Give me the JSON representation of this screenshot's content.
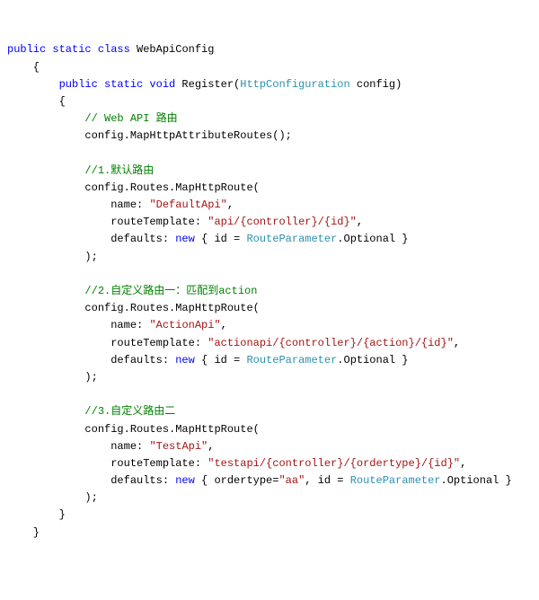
{
  "code": {
    "line1_kw": "public static class",
    "line1_cls": " WebApiConfig",
    "lbrace1": "    {",
    "line2_indent": "        ",
    "line2_kw": "public static void",
    "line2_method": " Register(",
    "line2_cls": "HttpConfiguration",
    "line2_end": " config)",
    "lbrace2": "        {",
    "cmt1_indent": "            ",
    "cmt1": "// Web API 路由",
    "map_indent": "            config.MapHttpAttributeRoutes();",
    "blank": "",
    "cmt2_indent": "            ",
    "cmt2": "//1.默认路由",
    "r1a": "            config.Routes.MapHttpRoute(",
    "r1b_pre": "                name: ",
    "r1b_str": "\"DefaultApi\"",
    "r1b_post": ",",
    "r1c_pre": "                routeTemplate: ",
    "r1c_str": "\"api/{controller}/{id}\"",
    "r1c_post": ",",
    "r1d_pre": "                defaults: ",
    "r1d_kw": "new ",
    "r1d_body": "{ id = ",
    "r1d_cls": "RouteParameter",
    "r1d_end": ".Optional }",
    "r1e": "            );",
    "cmt3_indent": "            ",
    "cmt3": "//2.自定义路由一：匹配到action",
    "r2a": "            config.Routes.MapHttpRoute(",
    "r2b_pre": "                name: ",
    "r2b_str": "\"ActionApi\"",
    "r2b_post": ",",
    "r2c_pre": "                routeTemplate: ",
    "r2c_str": "\"actionapi/{controller}/{action}/{id}\"",
    "r2c_post": ",",
    "r2d_pre": "                defaults: ",
    "r2d_kw": "new ",
    "r2d_body": "{ id = ",
    "r2d_cls": "RouteParameter",
    "r2d_end": ".Optional }",
    "r2e": "            );",
    "cmt4_indent": "            ",
    "cmt4": "//3.自定义路由二",
    "r3a": "            config.Routes.MapHttpRoute(",
    "r3b_pre": "                name: ",
    "r3b_str": "\"TestApi\"",
    "r3b_post": ",",
    "r3c_pre": "                routeTemplate: ",
    "r3c_str": "\"testapi/{controller}/{ordertype}/{id}\"",
    "r3c_post": ",",
    "r3d_pre": "                defaults: ",
    "r3d_kw": "new ",
    "r3d_body": "{ ordertype=",
    "r3d_str": "\"aa\"",
    "r3d_mid": ", id = ",
    "r3d_cls": "RouteParameter",
    "r3d_end": ".Optional }",
    "r3e": "            );",
    "rbrace2": "        }",
    "rbrace1": "    }"
  }
}
